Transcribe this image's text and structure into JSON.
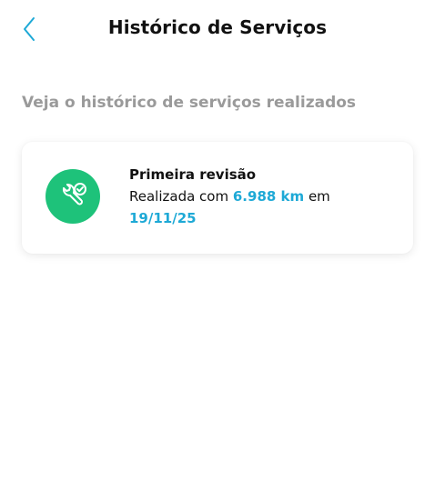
{
  "header": {
    "title": "Histórico de Serviços",
    "back_icon": "chevron-left-icon"
  },
  "subtitle": "Veja o histórico de serviços realizados",
  "services": [
    {
      "icon": "wrench-check-icon",
      "name": "Primeira revisão",
      "desc_prefix": "Realizada com",
      "mileage": "6.988 km",
      "desc_middle": "em",
      "date": "19/11/25"
    }
  ],
  "colors": {
    "accent": "#1ea9d6",
    "icon_bg": "#1ec27a",
    "subtitle": "#9a9a9a"
  }
}
